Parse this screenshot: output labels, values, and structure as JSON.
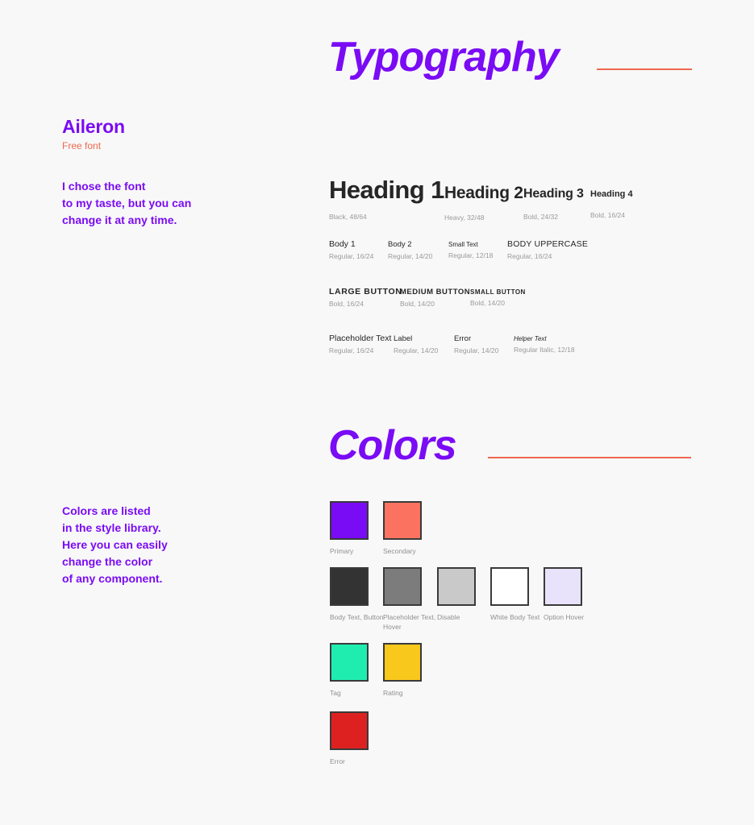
{
  "background_color": "#f8f8f8",
  "accent": {
    "purple": "#7a0bf5",
    "coral": "#f0674f",
    "text_dark": "#262626",
    "meta_gray": "#9a9a9a"
  },
  "sections": {
    "typography": {
      "title": "Typography",
      "font_name": "Aileron",
      "font_sub": "Free font",
      "note_lines": [
        "I chose the font",
        "to my taste, but you can",
        "change it at any time."
      ],
      "specimens": [
        {
          "sample": "Heading 1",
          "meta": "Black, 48/64"
        },
        {
          "sample": "Heading 2",
          "meta": "Heavy, 32/48"
        },
        {
          "sample": "Heading 3",
          "meta": "Bold, 24/32"
        },
        {
          "sample": "Heading 4",
          "meta": "Bold, 16/24"
        },
        {
          "sample": "Body 1",
          "meta": "Regular, 16/24"
        },
        {
          "sample": "Body 2",
          "meta": "Regular, 14/20"
        },
        {
          "sample": "Small Text",
          "meta": "Regular, 12/18"
        },
        {
          "sample": "BODY UPPERCASE",
          "meta": "Regular, 16/24"
        },
        {
          "sample": "LARGE BUTTON",
          "meta": "Bold, 16/24"
        },
        {
          "sample": "MEDIUM BUTTON",
          "meta": "Bold, 14/20"
        },
        {
          "sample": "SMALL BUTTON",
          "meta": "Bold, 14/20"
        },
        {
          "sample": "Placeholder Text",
          "meta": "Regular, 16/24"
        },
        {
          "sample": "Label",
          "meta": "Regular, 14/20"
        },
        {
          "sample": "Error",
          "meta": "Regular, 14/20"
        },
        {
          "sample": "Helper Text",
          "meta": "Regular Italic, 12/18"
        }
      ]
    },
    "colors": {
      "title": "Colors",
      "note_lines": [
        "Colors are listed",
        "in the style library.",
        "Here you can easily",
        "change the color",
        "of any component."
      ],
      "swatches": [
        {
          "label": "Primary",
          "hex": "#7a0bf5"
        },
        {
          "label": "Secondary",
          "hex": "#fb7360"
        },
        {
          "label": "Body Text, Button",
          "hex": "#333333"
        },
        {
          "label": "Placeholder Text, Hover",
          "hex": "#7c7c7c"
        },
        {
          "label": "Disable",
          "hex": "#c9c9c9"
        },
        {
          "label": "White Body Text",
          "hex": "#ffffff"
        },
        {
          "label": "Option Hover",
          "hex": "#e8e2fb"
        },
        {
          "label": "Tag",
          "hex": "#1fedb0"
        },
        {
          "label": "Rating",
          "hex": "#f8c81c"
        },
        {
          "label": "Error",
          "hex": "#dd2121"
        }
      ]
    }
  }
}
